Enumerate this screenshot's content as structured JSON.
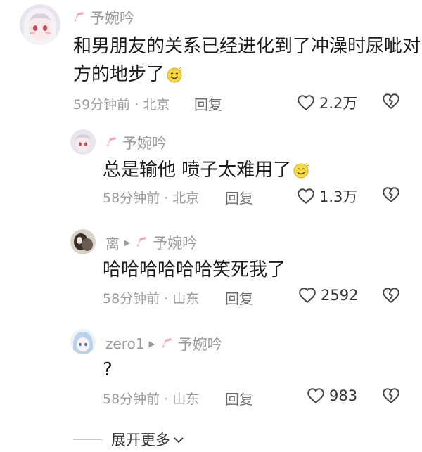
{
  "tag_color": "#f2a7b4",
  "comments": [
    {
      "author": "",
      "reply_to": "予婉吟",
      "text_line1": "和男朋友的关系已经进化到了冲澡时尿呲对",
      "text_line2": "方的地步了",
      "emoji": "smile-face-emoji",
      "meta": "59分钟前 · 北京",
      "reply_label": "回复",
      "likes": "2.2万"
    },
    {
      "author": "",
      "reply_to": "予婉吟",
      "text": "总是输他 喷子太难用了",
      "emoji": "smile-face-emoji",
      "meta": "58分钟前 · 北京",
      "reply_label": "回复",
      "likes": "1.3万"
    },
    {
      "author": "离",
      "reply_to": "予婉吟",
      "text": "哈哈哈哈哈哈笑死我了",
      "meta": "58分钟前 · 山东",
      "reply_label": "回复",
      "likes": "2592"
    },
    {
      "author": "zero1",
      "reply_to": "予婉吟",
      "text": "?",
      "meta": "58分钟前 · 山东",
      "reply_label": "回复",
      "likes": "983"
    }
  ],
  "expand_label": "展开更多"
}
